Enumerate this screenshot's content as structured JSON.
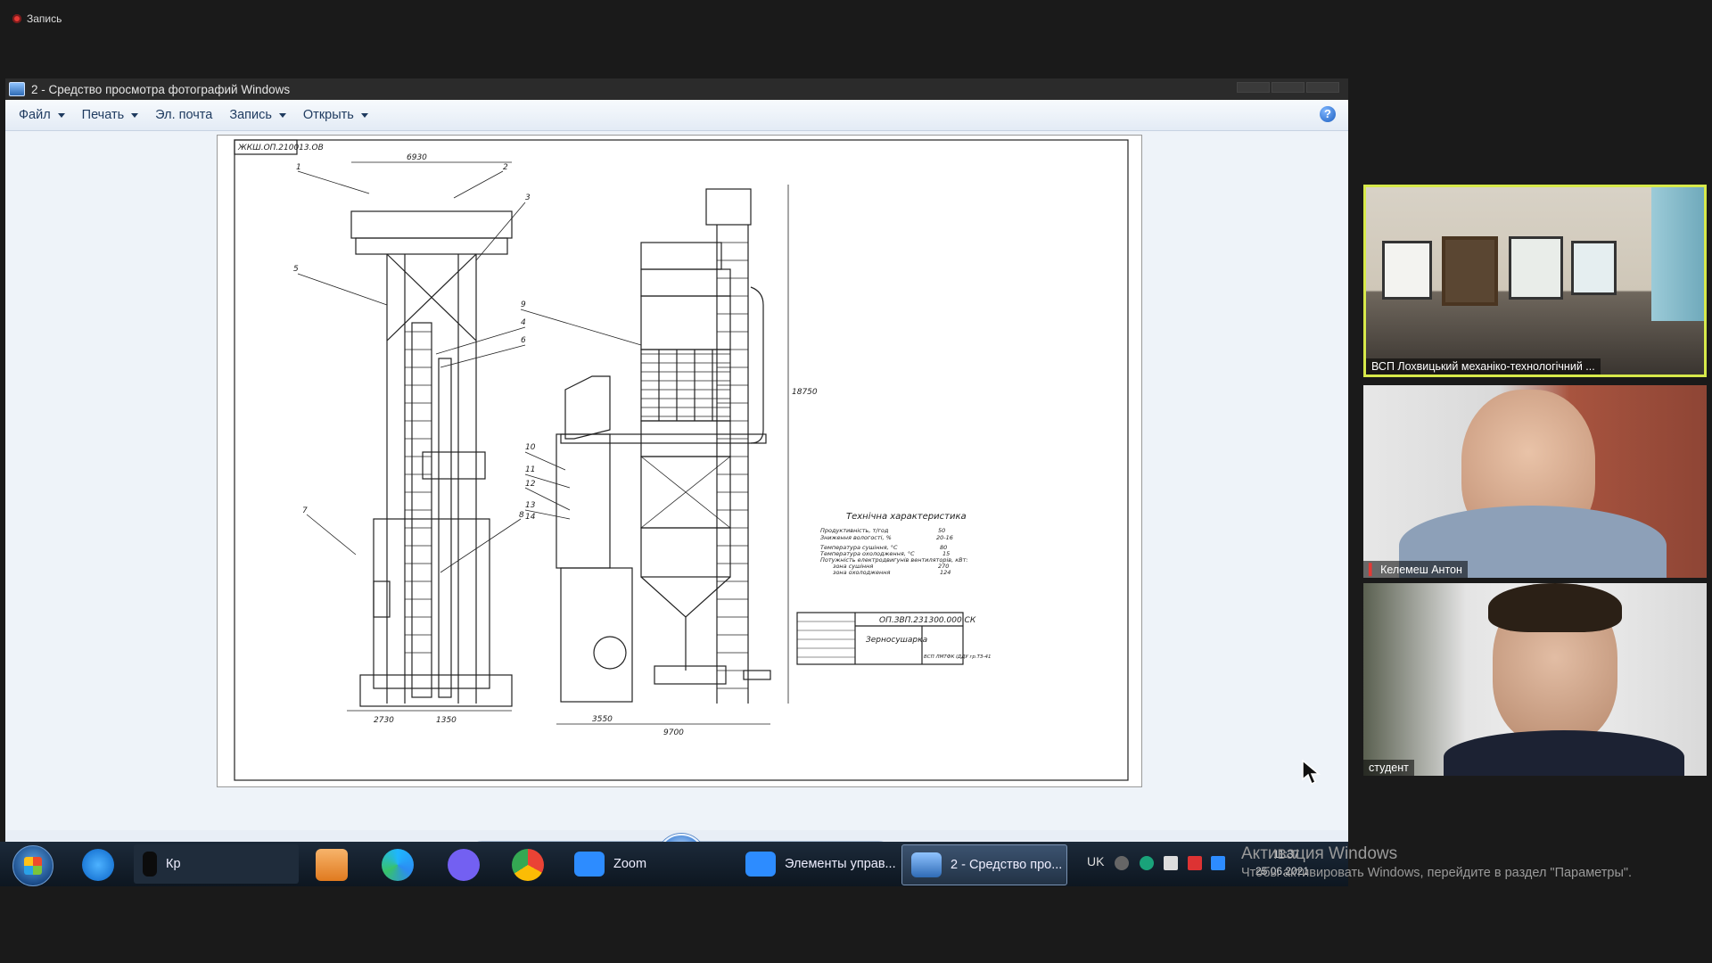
{
  "recording": {
    "label": "Запись"
  },
  "viewer": {
    "title": "2 - Средство просмотра фотографий Windows",
    "menu": [
      {
        "label": "Файл",
        "has_dropdown": true
      },
      {
        "label": "Печать",
        "has_dropdown": true
      },
      {
        "label": "Эл. почта",
        "has_dropdown": false
      },
      {
        "label": "Запись",
        "has_dropdown": true
      },
      {
        "label": "Открыть",
        "has_dropdown": true
      }
    ],
    "toolbar_icons": [
      "zoom-icon",
      "fit-icon",
      "previous-icon",
      "slideshow-icon",
      "next-icon",
      "rotate-left-icon",
      "rotate-right-icon",
      "delete-icon"
    ]
  },
  "drawing": {
    "corner_stamp": "ЖКШ.ОП.210013.ОВ",
    "dim_top": "6930",
    "dim_height": "18750",
    "dim_bottom_left_1": "2730",
    "dim_bottom_left_2": "1350",
    "dim_bottom_right_1": "3550",
    "dim_bottom_right_2": "9700",
    "callouts": [
      "1",
      "2",
      "3",
      "4",
      "5",
      "6",
      "7",
      "8",
      "9",
      "10",
      "11",
      "12",
      "13",
      "14"
    ],
    "tech_title": "Технічна характеристика",
    "tech_rows": [
      {
        "name": "Продуктивність, т/год",
        "value": "50"
      },
      {
        "name": "Зниження вологості, %",
        "value": "20-16"
      },
      {
        "name": "Температура сушіння, °С",
        "value": "80"
      },
      {
        "name": "Температура охолодження, °С",
        "value": "15"
      },
      {
        "name": "Потужність електродвигунів вентиляторів, кВт:",
        "value": ""
      },
      {
        "name": "зона сушіння",
        "value": "270"
      },
      {
        "name": "зона охолодження",
        "value": "124"
      }
    ],
    "title_block_code": "ОП.ЗВП.231300.000 СК",
    "title_block_name": "Зерносушарка",
    "title_block_group": "ВСП ЛМТФК ІДДУ гр.ТЗ-41"
  },
  "taskbar": {
    "items": [
      {
        "label": "Кр",
        "icon": "app-icon"
      },
      {
        "label": "Zoom",
        "icon": "zoom-app-icon"
      },
      {
        "label": "Элементы управ...",
        "icon": "zoom-app-icon"
      },
      {
        "label": "2 - Средство про...",
        "icon": "photo-viewer-icon"
      }
    ],
    "pinned": [
      "internet-explorer-icon",
      "media-player-icon",
      "edge-icon",
      "viber-icon",
      "chrome-icon"
    ],
    "language": "UK",
    "time": "11:37",
    "date": "25.06.2021"
  },
  "activation": {
    "line1": "Активация Windows",
    "line2": "Чтобы активировать Windows, перейдите в раздел \"Параметры\"."
  },
  "participants": [
    {
      "name": "ВСП Лохвицький механіко-технологічний ...",
      "active_speaker": true,
      "muted": false
    },
    {
      "name": "Келемеш Антон",
      "active_speaker": false,
      "muted": true
    },
    {
      "name": "студент",
      "active_speaker": false,
      "muted": false
    }
  ],
  "colors": {
    "active_speaker_border": "#d7e94a",
    "muted_icon": "#e53935",
    "window_menubar": "#e3ebf5",
    "taskbar": "#0d1620"
  }
}
